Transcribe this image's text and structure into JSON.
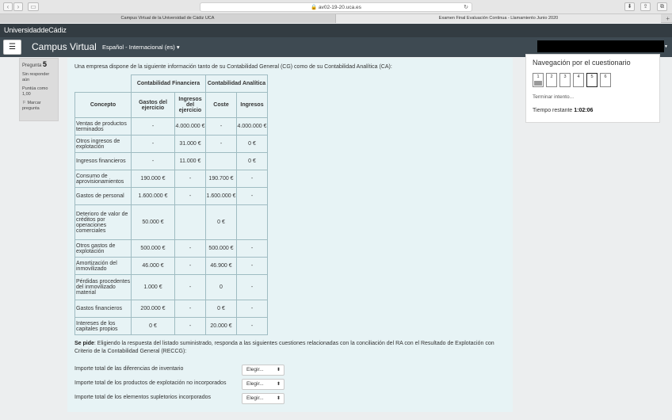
{
  "browser": {
    "url": "av02-19-20.uca.es",
    "tabs": [
      "Campus Virtual de la Universidad de Cádiz UCA",
      "Examen Final Evaluación Continua - Llamamiento Junio 2020"
    ],
    "new_tab": "+"
  },
  "header": {
    "brand": "UniversidaddeCádiz",
    "site_name": "Campus Virtual",
    "language": "Español - Internacional (es)"
  },
  "question_info": {
    "label": "Pregunta",
    "number": "5",
    "status": "Sin responder aún",
    "score": "Puntúa como 1,00",
    "flag": "Marcar pregunta"
  },
  "question": {
    "intro": "Una empresa dispone de la siguiente información tanto de su Contabilidad General (CG) como de su Contabilidad Analítica (CA):",
    "table": {
      "group_cf": "Contabilidad Financiera",
      "group_ca": "Contabilidad Analítica",
      "col_concepto": "Concepto",
      "col_gastos": "Gastos del ejercicio",
      "col_ingresos_ej": "Ingresos del ejercicio",
      "col_coste": "Coste",
      "col_ingresos": "Ingresos",
      "rows": [
        [
          "Ventas de productos terminados",
          "-",
          "4.000.000 €",
          "-",
          "4.000.000 €"
        ],
        [
          "Otros ingresos de explotación",
          "-",
          "31.000 €",
          "-",
          "0 €"
        ],
        [
          "Ingresos financieros",
          "-",
          "11.000 €",
          "",
          "0 €"
        ],
        [
          "Consumo de aprovisionamientos",
          "190.000 €",
          "-",
          "190.700 €",
          "-"
        ],
        [
          "Gastos de personal",
          "1.600.000 €",
          "-",
          "1.600.000 €",
          "-"
        ],
        [
          "Deterioro de valor de créditos por operaciones comerciales",
          "50.000 €",
          "",
          "0 €",
          ""
        ],
        [
          "Otros gastos de explotación",
          "500.000 €",
          "-",
          "500.000 €",
          "-"
        ],
        [
          "Amortización del inmovilizado",
          "46.000 €",
          "-",
          "46.900 €",
          "-"
        ],
        [
          "Pérdidas procedentes del inmovilizado material",
          "1.000 €",
          "-",
          "0",
          "-"
        ],
        [
          "Gastos financieros",
          "200.000 €",
          "-",
          "0 €",
          "-"
        ],
        [
          "Intereses de los capitales propios",
          "0 €",
          "-",
          "20.000 €",
          "-"
        ]
      ]
    },
    "pide_label": "Se pide",
    "pide_text": ": Eligiendo la respuesta del listado suministrado, responda a las siguientes cuestiones relacionadas con la conciliación del RA con el Resultado de Explotación con Criterio de la Contabilidad General (RECCG):",
    "subquestions": [
      {
        "label": "Importe total de las diferencias de inventario",
        "select": "Elegir..."
      },
      {
        "label": "Importe total de los productos de explotación no incorporados",
        "select": "Elegir..."
      },
      {
        "label": "Importe total de los elementos supletorios incorporados",
        "select": "Elegir..."
      }
    ]
  },
  "nav": {
    "title": "Navegación por el cuestionario",
    "buttons": [
      "1",
      "2",
      "3",
      "4",
      "5",
      "6"
    ],
    "end_attempt": "Terminar intento...",
    "timer_label": "Tiempo restante",
    "timer_value": "1:02:06"
  }
}
